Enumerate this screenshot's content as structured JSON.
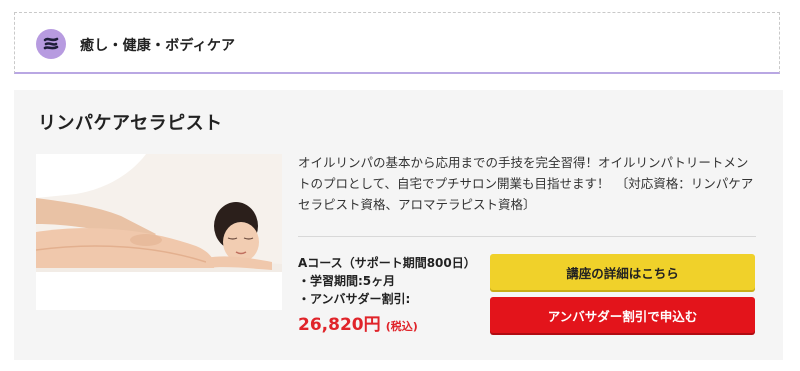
{
  "category": {
    "icon": "wave-lines-icon",
    "label": "癒し・健康・ボディケア",
    "accent_color": "#b79be0"
  },
  "course": {
    "title": "リンパケアセラピスト",
    "image": "massage-photo",
    "description": "オイルリンパの基本から応用までの手技を完全習得！オイルリンパトリートメントのプロとして、自宅でプチサロン開業も目指せます！　〔対応資格：リンパケアセラピスト資格、アロマテラピスト資格〕",
    "plan_name": "Aコース（サポート期間800日）",
    "period": "・学習期間:5ヶ月",
    "ambassador_label": "・アンバサダー割引:",
    "price": "26,820円",
    "tax_note": "(税込)",
    "price_color": "#e0242a"
  },
  "buttons": {
    "details_label": "講座の詳細はこちら",
    "details_color": "#f0d12a",
    "apply_label": "アンバサダー割引で申込む",
    "apply_color": "#e3141b"
  }
}
